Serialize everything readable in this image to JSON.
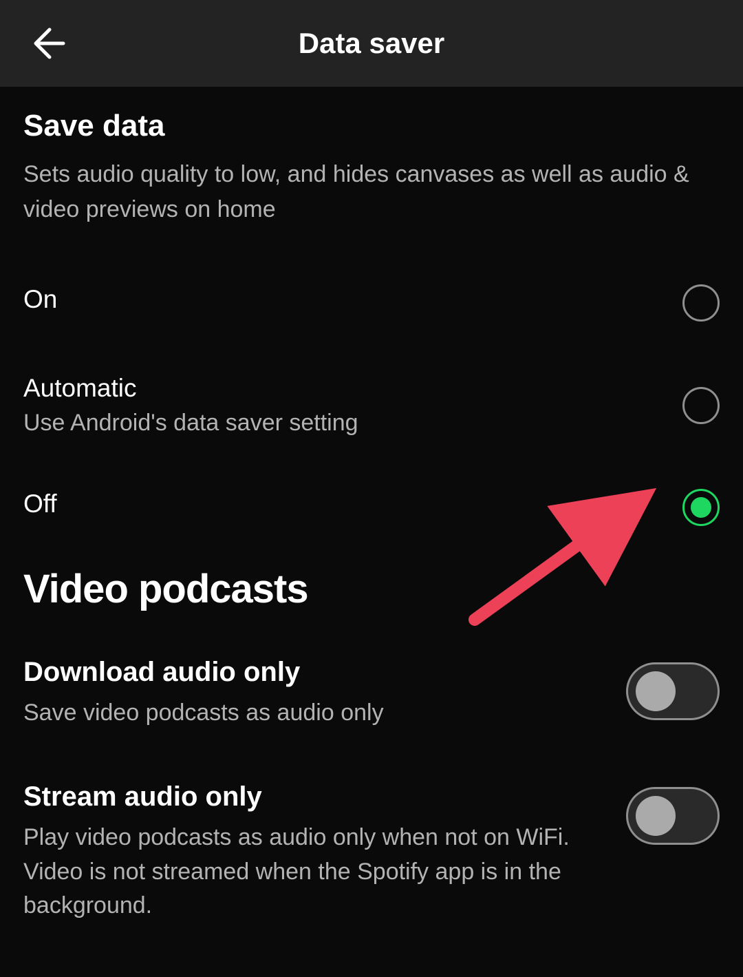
{
  "header": {
    "title": "Data saver"
  },
  "saveData": {
    "title": "Save data",
    "description": "Sets audio quality to low, and hides canvases as well as audio & video previews on home",
    "options": [
      {
        "label": "On",
        "sublabel": "",
        "selected": false
      },
      {
        "label": "Automatic",
        "sublabel": "Use Android's data saver setting",
        "selected": false
      },
      {
        "label": "Off",
        "sublabel": "",
        "selected": true
      }
    ]
  },
  "videoPodcasts": {
    "heading": "Video podcasts",
    "items": [
      {
        "label": "Download audio only",
        "sublabel": "Save video podcasts as audio only",
        "on": false
      },
      {
        "label": "Stream audio only",
        "sublabel": "Play video podcasts as audio only when not on WiFi. Video is not streamed when the Spotify app is in the background.",
        "on": false
      }
    ]
  },
  "colors": {
    "accent": "#1ed760",
    "annotationArrow": "#ed4158"
  }
}
